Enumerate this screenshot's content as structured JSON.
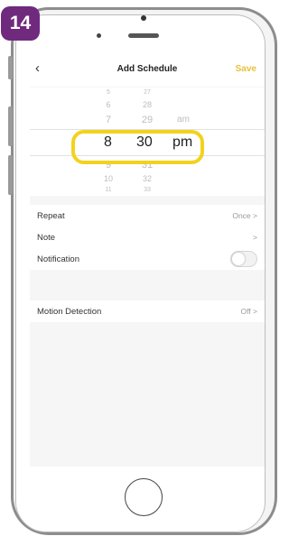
{
  "step": {
    "number": "14",
    "color": "#6f2a7e"
  },
  "header": {
    "back_icon": "chevron-left-icon",
    "title": "Add Schedule",
    "save_label": "Save",
    "save_color": "#e8c23a"
  },
  "time_picker": {
    "hours_above": [
      "5",
      "6",
      "7"
    ],
    "hour": "8",
    "hours_below": [
      "9",
      "10",
      "11"
    ],
    "minutes_above": [
      "27",
      "28",
      "29"
    ],
    "minute": "30",
    "minutes_below": [
      "31",
      "32",
      "33"
    ],
    "period_above": "am",
    "period": "pm",
    "highlight_color": "#f3d21d"
  },
  "settings": {
    "repeat": {
      "label": "Repeat",
      "value": "Once",
      "chevron": ">"
    },
    "note": {
      "label": "Note",
      "chevron": ">"
    },
    "notification": {
      "label": "Notification",
      "enabled": false
    },
    "motion_detection": {
      "label": "Motion Detection",
      "value": "Off",
      "chevron": ">"
    }
  }
}
